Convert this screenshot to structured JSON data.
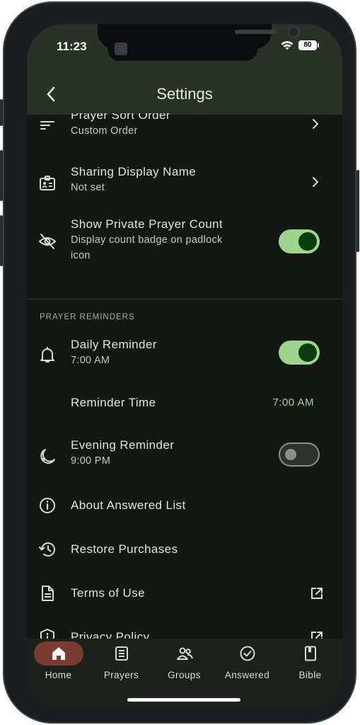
{
  "status": {
    "time": "11:23",
    "battery": "80"
  },
  "header": {
    "title": "Settings"
  },
  "settings": {
    "prayer_sort": {
      "label": "Prayer Sort Order",
      "value": "Custom Order"
    },
    "sharing_name": {
      "label": "Sharing Display Name",
      "value": "Not set"
    },
    "private_count": {
      "label": "Show Private Prayer Count",
      "description_line1": "Display count badge on padlock",
      "description_line2": "icon",
      "enabled": true
    },
    "section_reminders": "PRAYER REMINDERS",
    "daily_reminder": {
      "label": "Daily Reminder",
      "value": "7:00 AM",
      "enabled": true
    },
    "reminder_time": {
      "label": "Reminder Time",
      "value": "7:00 AM"
    },
    "evening_reminder": {
      "label": "Evening Reminder",
      "value": "9:00 PM",
      "enabled": false
    },
    "about_answered": {
      "label": "About Answered List"
    },
    "restore_purchases": {
      "label": "Restore Purchases"
    },
    "terms": {
      "label": "Terms of Use"
    },
    "privacy": {
      "label": "Privacy Policy"
    }
  },
  "nav": {
    "items": [
      {
        "label": "Home",
        "icon": "home-icon",
        "active": true
      },
      {
        "label": "Prayers",
        "icon": "list-icon",
        "active": false
      },
      {
        "label": "Groups",
        "icon": "groups-icon",
        "active": false
      },
      {
        "label": "Answered",
        "icon": "check-circle-icon",
        "active": false
      },
      {
        "label": "Bible",
        "icon": "book-icon",
        "active": false
      }
    ]
  },
  "colors": {
    "accent": "#9fd48f",
    "active_nav": "#7a3b33",
    "background": "#141714",
    "app_bar": "#2a3227"
  }
}
